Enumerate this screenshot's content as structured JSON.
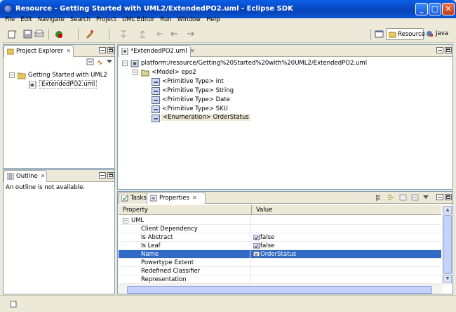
{
  "window": {
    "title": "Resource - Getting Started with UML2/ExtendedPO2.uml - Eclipse SDK",
    "min": "_",
    "max": "□",
    "close": "✕"
  },
  "menu": [
    "File",
    "Edit",
    "Navigate",
    "Search",
    "Project",
    "UML Editor",
    "Run",
    "Window",
    "Help"
  ],
  "perspectives": {
    "resource": "Resource",
    "java": "Java"
  },
  "project_explorer": {
    "tab": "Project Explorer",
    "tree": [
      {
        "label": "Getting Started with UML2",
        "expander": "−"
      },
      {
        "label": "ExtendedPO2.uml"
      }
    ]
  },
  "outline": {
    "tab": "Outline",
    "message": "An outline is not available."
  },
  "editor": {
    "tab": "*ExtendedPO2.uml",
    "tree": [
      {
        "label": "platform:/resource/Getting%20Started%20with%20UML2/ExtendedPO2.uml",
        "expander": "−"
      },
      {
        "label": "<Model> epo2",
        "expander": "−"
      },
      {
        "label": "<Primitive Type> int"
      },
      {
        "label": "<Primitive Type> String"
      },
      {
        "label": "<Primitive Type> Date"
      },
      {
        "label": "<Primitive Type> SKU"
      },
      {
        "label": "<Enumeration> OrderStatus"
      }
    ]
  },
  "bottom": {
    "tabs": [
      "Tasks",
      "Properties"
    ],
    "headers": {
      "property": "Property",
      "value": "Value"
    },
    "rows": [
      {
        "property": "UML",
        "value": "",
        "expander": "−"
      },
      {
        "property": "Client Dependency",
        "value": ""
      },
      {
        "property": "Is Abstract",
        "value": "false"
      },
      {
        "property": "Is Leaf",
        "value": "false"
      },
      {
        "property": "Name",
        "value": "OrderStatus"
      },
      {
        "property": "Powertype Extent",
        "value": ""
      },
      {
        "property": "Redefined Classifier",
        "value": ""
      },
      {
        "property": "Representation",
        "value": ""
      }
    ]
  },
  "scroll": {
    "up": "▲",
    "down": "▼"
  }
}
